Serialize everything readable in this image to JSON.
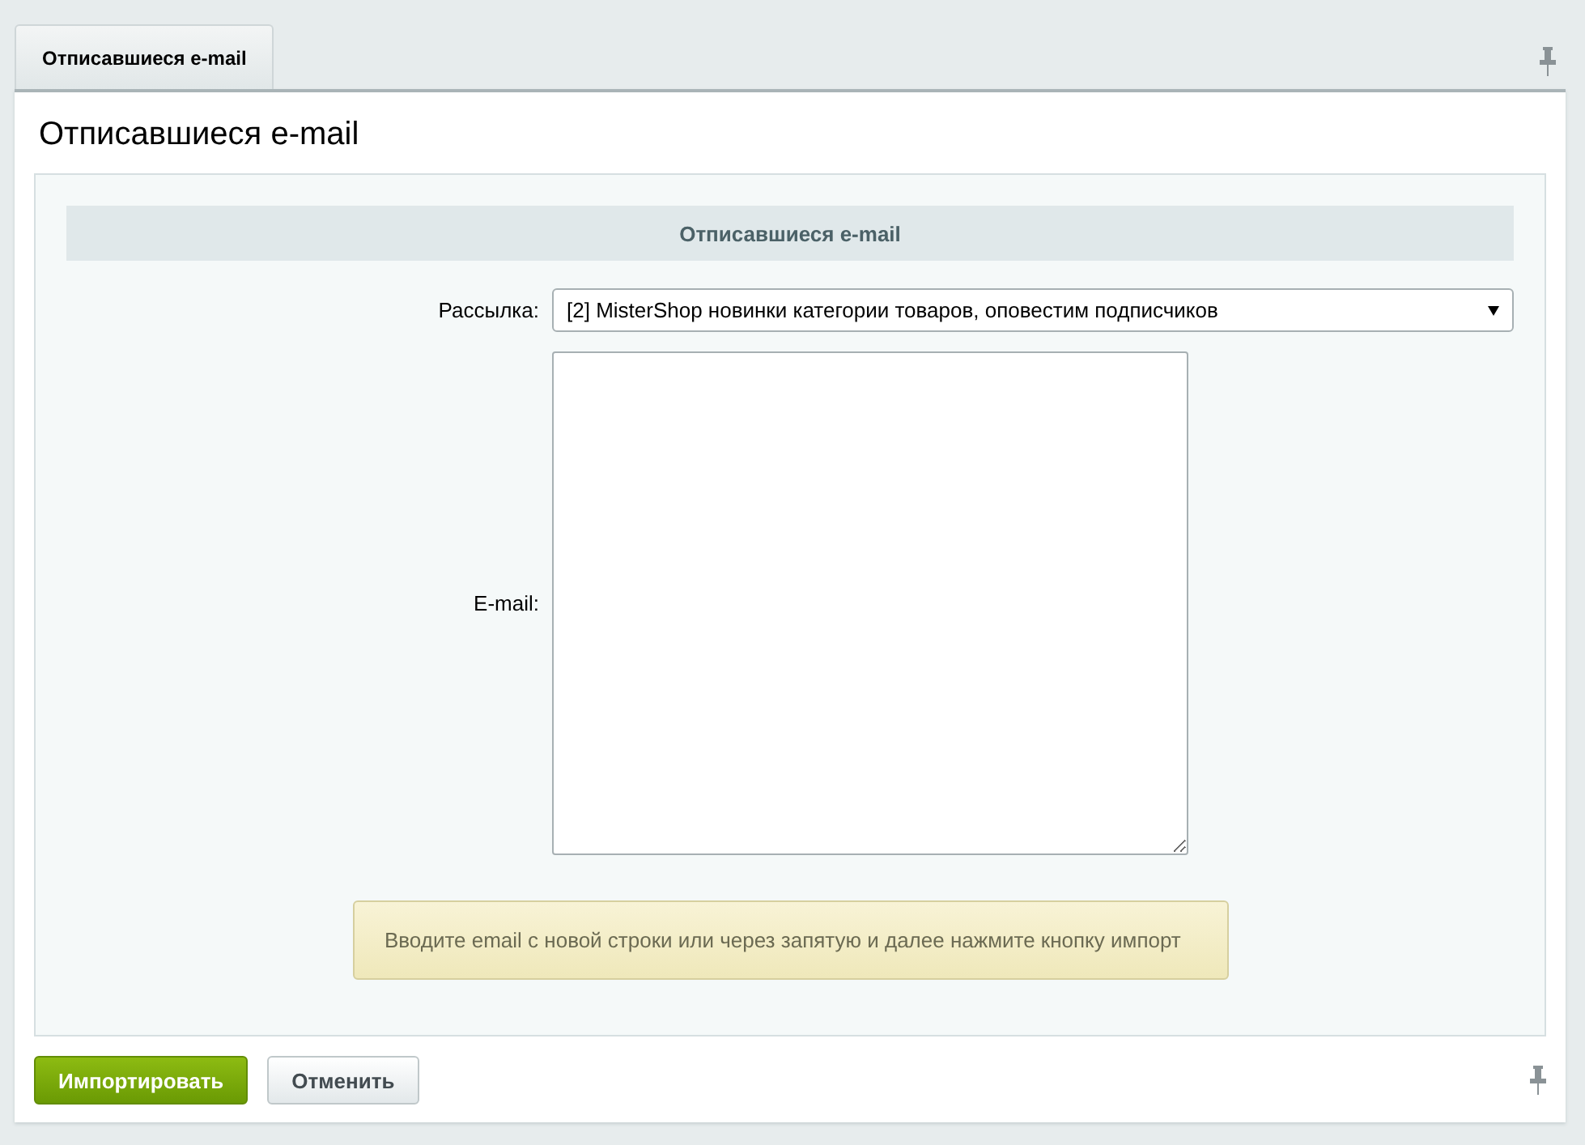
{
  "tabs": [
    {
      "label": "Отписавшиеся e-mail",
      "selected": true
    }
  ],
  "page_title": "Отписавшиеся e-mail",
  "section_header": "Отписавшиеся e-mail",
  "fields": [
    {
      "kind": "select",
      "label": "Рассылка:",
      "value": "[2] MisterShop новинки категории товаров, оповестим подписчиков"
    },
    {
      "kind": "textarea",
      "label": "E-mail:"
    }
  ],
  "note": "Вводите email с новой строки или через запятую и далее нажмите кнопку импорт",
  "buttons": [
    {
      "label": "Импортировать",
      "kind": "primary"
    },
    {
      "label": "Отменить",
      "kind": "secondary"
    }
  ]
}
